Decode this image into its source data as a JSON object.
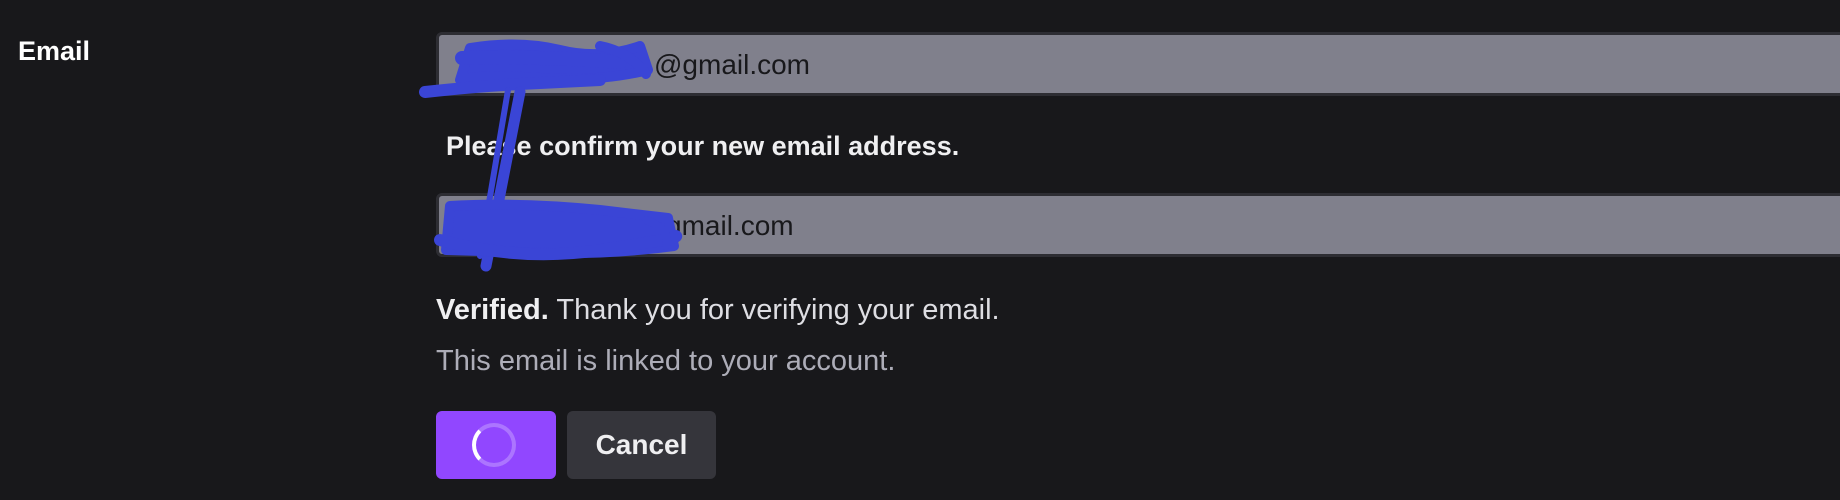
{
  "section": {
    "label": "Email"
  },
  "email_field": {
    "value_visible": "@gmail.com"
  },
  "confirm_prompt": "Please confirm your new email address.",
  "confirm_field": {
    "value_visible": "gmail.com"
  },
  "status": {
    "verified_bold": "Verified.",
    "verified_text": " Thank you for verifying your email."
  },
  "linked_text": "This email is linked to your account.",
  "buttons": {
    "save": {
      "state": "loading",
      "icon": "spinner-icon"
    },
    "cancel_label": "Cancel"
  },
  "colors": {
    "background": "#18181b",
    "field_fill": "#80808c",
    "accent": "#9147ff",
    "secondary_button": "#35353b",
    "redaction_scribble": "#3a45d6"
  }
}
